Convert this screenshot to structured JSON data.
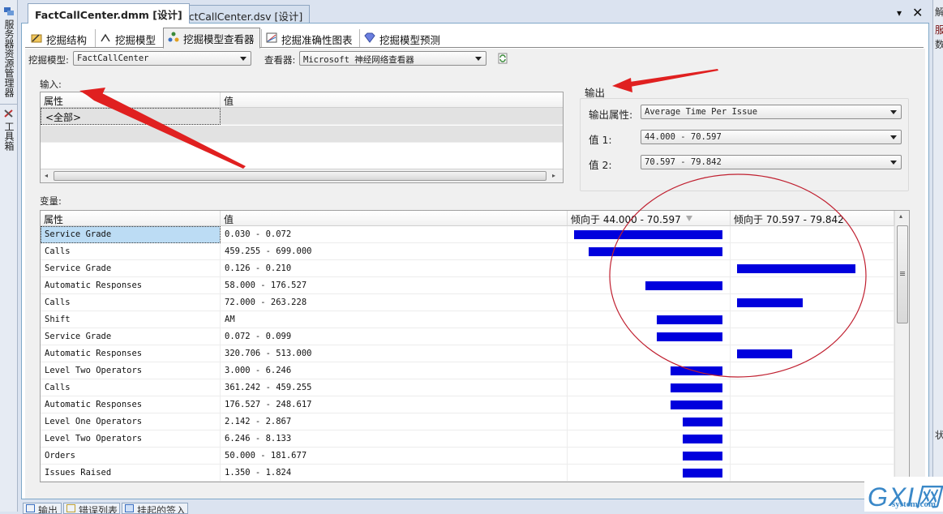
{
  "side_panels": {
    "left_items": [
      {
        "label": "服务器资源管理器",
        "icon": "server-explorer-icon"
      },
      {
        "label": "工具箱",
        "icon": "toolbox-icon"
      }
    ],
    "right_header": "解",
    "right_items": [
      "服",
      "数"
    ],
    "right_bottom_label": "状"
  },
  "document_tabs": [
    {
      "label": "FactCallCenter.dmm [设计]",
      "active": true
    },
    {
      "label": "FactCallCenter.dsv [设计]",
      "active": false
    }
  ],
  "window_controls": {
    "dropdown": "▾",
    "close": "✕"
  },
  "designer_tabs": [
    {
      "label": "挖掘结构",
      "icon": "mining-structure-icon",
      "active": false
    },
    {
      "label": "挖掘模型",
      "icon": "mining-model-icon",
      "active": false
    },
    {
      "label": "挖掘模型查看器",
      "icon": "model-viewer-icon",
      "active": true
    },
    {
      "label": "挖掘准确性图表",
      "icon": "accuracy-chart-icon",
      "active": false
    },
    {
      "label": "挖掘模型预测",
      "icon": "prediction-icon",
      "active": false
    }
  ],
  "toolbar": {
    "model_label": "挖掘模型:",
    "model_value": "FactCallCenter",
    "viewer_label": "查看器:",
    "viewer_value": "Microsoft 神经网络查看器",
    "refresh_icon": "refresh-icon"
  },
  "input": {
    "title": "输入:",
    "columns": [
      "属性",
      "值"
    ],
    "rows": [
      {
        "attribute": "<全部>",
        "value": ""
      }
    ]
  },
  "output": {
    "title": "输出",
    "attribute_label": "输出属性:",
    "attribute_value": "Average Time Per Issue",
    "value1_label": "值 1:",
    "value1": "44.000 - 70.597",
    "value2_label": "值 2:",
    "value2": "70.597 - 79.842"
  },
  "variables": {
    "title": "变量:",
    "columns": [
      "属性",
      "值",
      "倾向于 44.000 - 70.597",
      "倾向于 70.597 - 79.842"
    ],
    "sort_icon": "sort-desc-icon",
    "bar_color": "#0000dd",
    "rows": [
      {
        "attribute": "Service Grade",
        "value": "0.030 - 0.072",
        "favors1": 100,
        "favors2": 0
      },
      {
        "attribute": "Calls",
        "value": "459.255 - 699.000",
        "favors1": 90,
        "favors2": 0
      },
      {
        "attribute": "Service Grade",
        "value": "0.126 - 0.210",
        "favors1": 0,
        "favors2": 80
      },
      {
        "attribute": "Automatic Responses",
        "value": "58.000 - 176.527",
        "favors1": 52,
        "favors2": 0
      },
      {
        "attribute": "Calls",
        "value": "72.000 - 263.228",
        "favors1": 0,
        "favors2": 44
      },
      {
        "attribute": "Shift",
        "value": "AM",
        "favors1": 44,
        "favors2": 0
      },
      {
        "attribute": "Service Grade",
        "value": "0.072 - 0.099",
        "favors1": 44,
        "favors2": 0
      },
      {
        "attribute": "Automatic Responses",
        "value": "320.706 - 513.000",
        "favors1": 0,
        "favors2": 37
      },
      {
        "attribute": "Level Two Operators",
        "value": "3.000 - 6.246",
        "favors1": 35,
        "favors2": 0
      },
      {
        "attribute": "Calls",
        "value": "361.242 - 459.255",
        "favors1": 35,
        "favors2": 0
      },
      {
        "attribute": "Automatic Responses",
        "value": "176.527 - 248.617",
        "favors1": 35,
        "favors2": 0
      },
      {
        "attribute": "Level One Operators",
        "value": "2.142 - 2.867",
        "favors1": 27,
        "favors2": 0
      },
      {
        "attribute": "Level Two Operators",
        "value": "6.246 - 8.133",
        "favors1": 27,
        "favors2": 0
      },
      {
        "attribute": "Orders",
        "value": "50.000 - 181.677",
        "favors1": 27,
        "favors2": 0
      },
      {
        "attribute": "Issues Raised",
        "value": "1.350 - 1.824",
        "favors1": 27,
        "favors2": 0
      }
    ]
  },
  "bottom_tabs": [
    {
      "label": "输出",
      "icon": "output-icon"
    },
    {
      "label": "错误列表",
      "icon": "error-list-icon"
    },
    {
      "label": "挂起的签入",
      "icon": "pending-checkins-icon"
    }
  ],
  "watermark": {
    "big": "GXI网",
    "small": "system.com"
  },
  "annotation_color": "#e02020"
}
